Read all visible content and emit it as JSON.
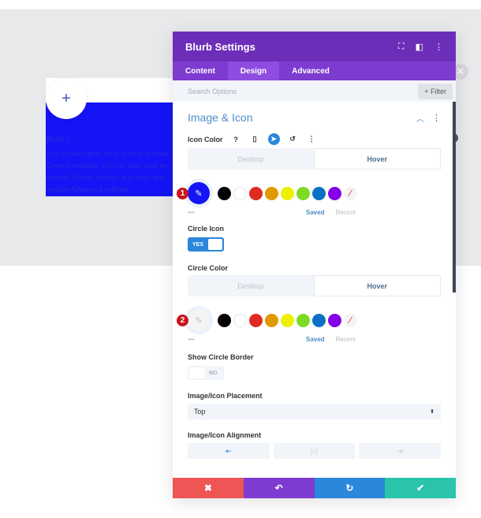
{
  "preview": {
    "plus": "+",
    "title": "Blurb 1",
    "lines": [
      "Your content goes here. Edit or remove",
      "Content settings. You can also style ev",
      "module Design settings and even app",
      "module Advanced settings."
    ]
  },
  "panel": {
    "title": "Blurb Settings",
    "tabs": [
      "Content",
      "Design",
      "Advanced"
    ],
    "active_tab": "Design",
    "search_placeholder": "Search Options",
    "filter": "+ Filter",
    "section": "Image & Icon",
    "icon_color": {
      "label": "Icon Color",
      "modes": [
        "Desktop",
        "Hover"
      ],
      "active_mode": "Hover",
      "selected": "#1414f5",
      "marker": "1"
    },
    "swatches": [
      "#000000",
      "#ffffff",
      "#e02b20",
      "#e09900",
      "#edf000",
      "#7cda24",
      "#0c71c3",
      "#8300e9"
    ],
    "saved": "Saved",
    "recent": "Recent",
    "more": "•••",
    "circle_icon": {
      "label": "Circle Icon",
      "value": "YES"
    },
    "circle_color": {
      "label": "Circle Color",
      "modes": [
        "Desktop",
        "Hover"
      ],
      "active_mode": "Hover",
      "marker": "2"
    },
    "show_circle_border": {
      "label": "Show Circle Border",
      "value": "NO"
    },
    "placement": {
      "label": "Image/Icon Placement",
      "value": "Top"
    },
    "alignment": {
      "label": "Image/Icon Alignment",
      "options": [
        "left",
        "center",
        "right"
      ],
      "selected": "left"
    },
    "footer": {
      "cancel": "✖",
      "undo": "↶",
      "redo": "↻",
      "save": "✔"
    }
  },
  "colors": {
    "header": "#6c2eb9",
    "tabs": "#7d3bd0",
    "accent": "#2b87da",
    "cancel": "#ef5555",
    "undo": "#7e3bd0",
    "redo": "#2b87da",
    "save": "#29c4a9"
  }
}
